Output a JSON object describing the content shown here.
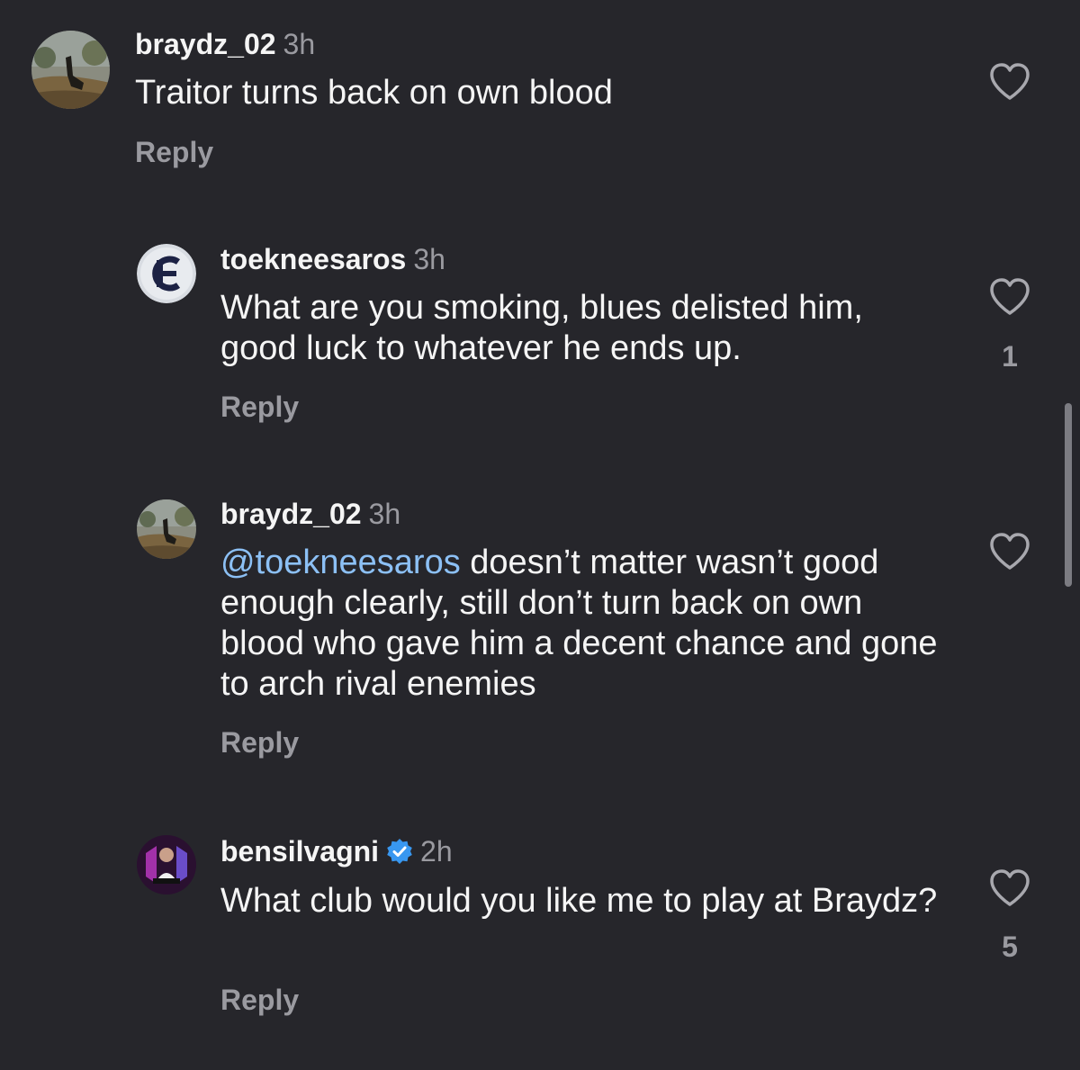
{
  "comments": [
    {
      "username": "braydz_02",
      "time": "3h",
      "text": "Traitor turns back on own blood",
      "reply_label": "Reply",
      "likes": ""
    },
    {
      "username": "toekneesaros",
      "time": "3h",
      "text": "What are you smoking, blues delisted him, good luck to whatever he ends up.",
      "reply_label": "Reply",
      "likes": "1"
    },
    {
      "username": "braydz_02",
      "time": "3h",
      "mention": "@toekneesaros",
      "text": " doesn’t matter wasn’t good enough clearly, still don’t turn back on own blood who gave him a decent chance and gone to arch rival enemies",
      "reply_label": "Reply",
      "likes": ""
    },
    {
      "username": "bensilvagni",
      "verified": true,
      "time": "2h",
      "text": "What club would you like me to play at Braydz?",
      "reply_label": "Reply",
      "likes": "5"
    }
  ],
  "colors": {
    "background": "#26262b",
    "mention": "#8cc0f5",
    "verified": "#3897f0",
    "muted": "#9a9aa0"
  }
}
